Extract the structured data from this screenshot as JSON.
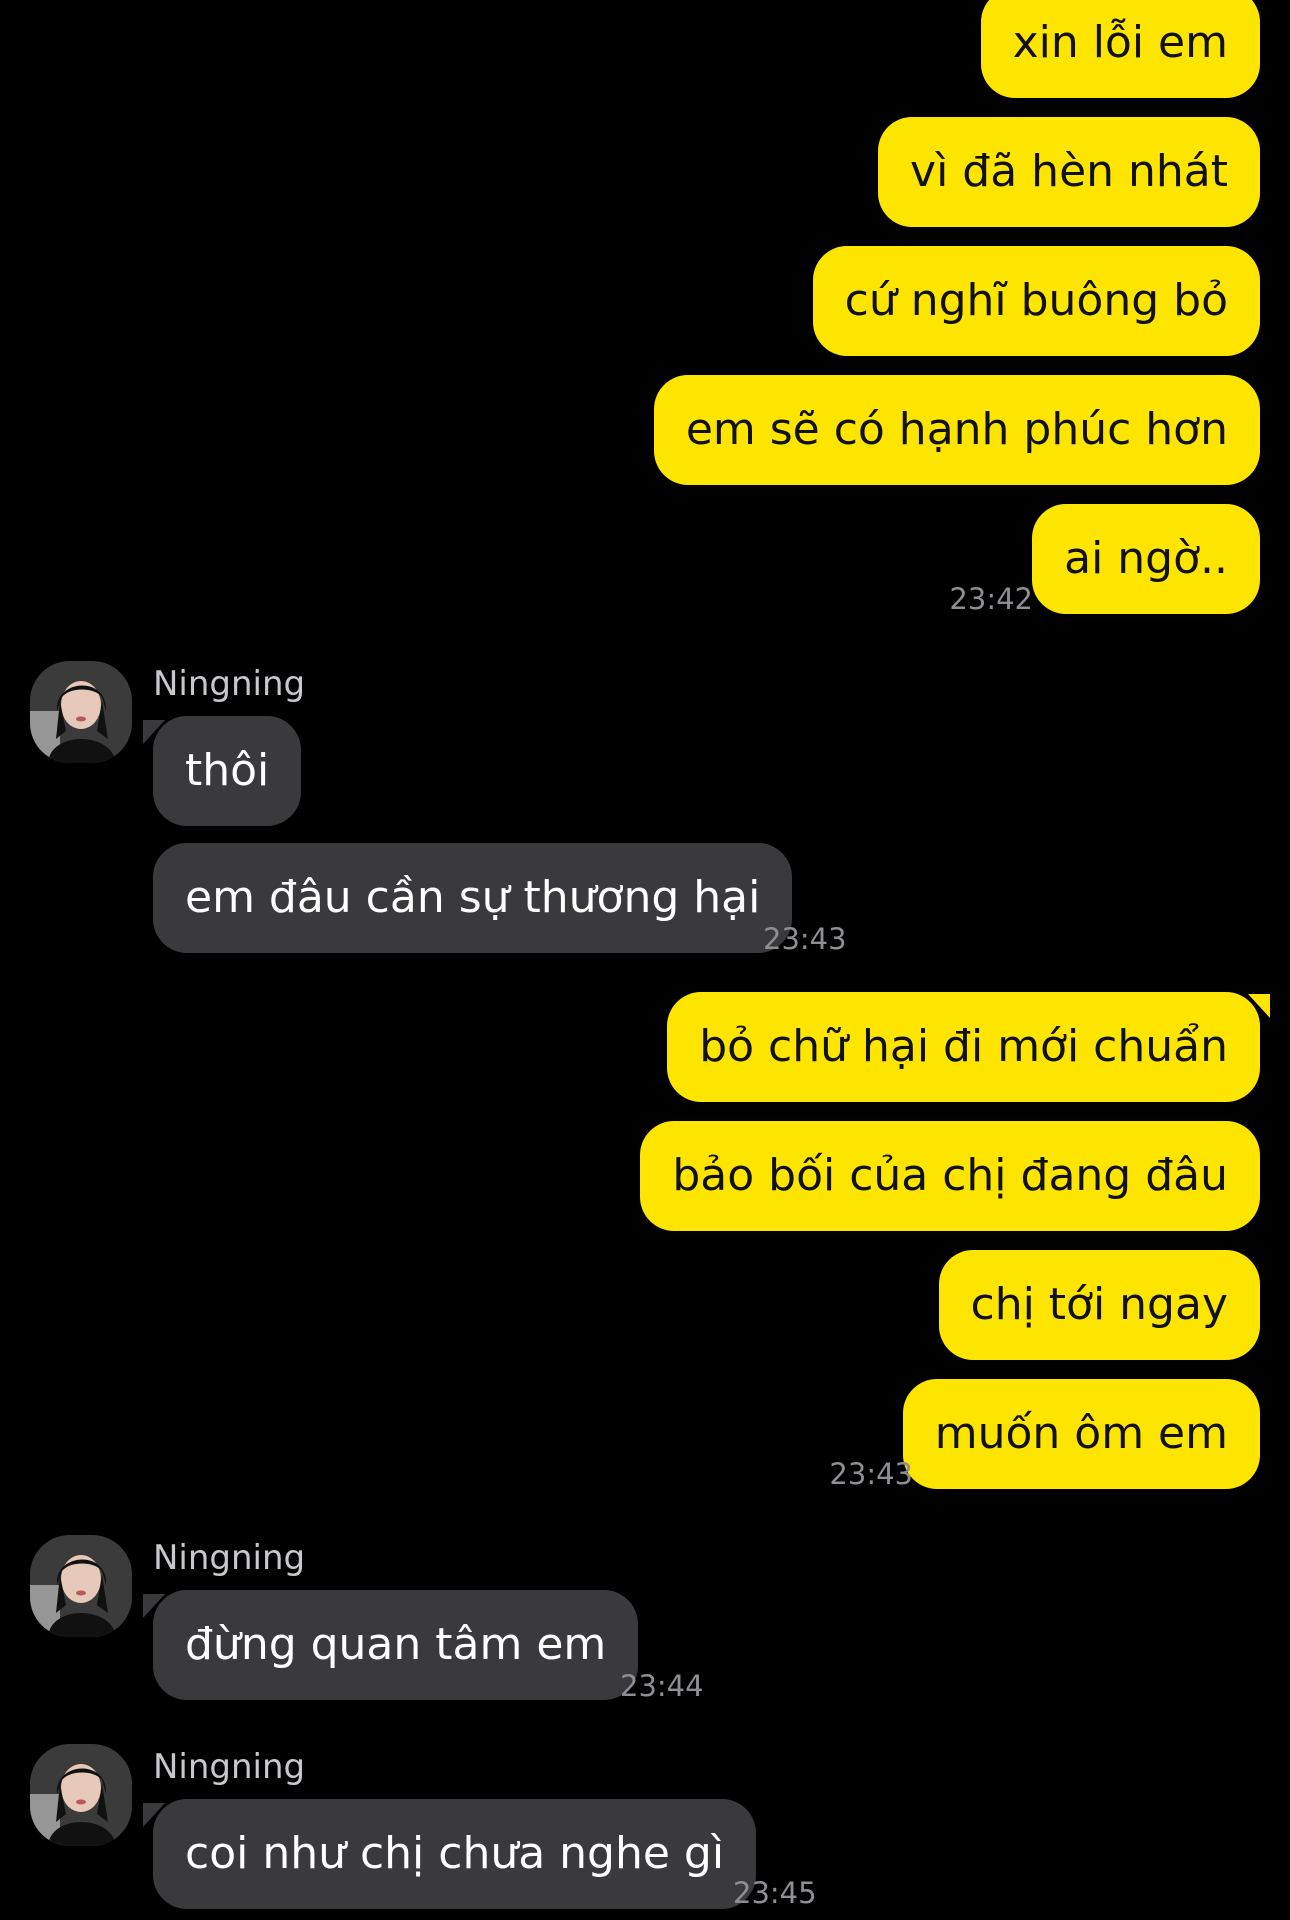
{
  "app": {
    "accent_color": "#FEE500",
    "incoming_bubble_color": "#3A3A3C",
    "background_color": "#000000"
  },
  "messages": [
    {
      "from": "me",
      "text": "xin lỗi em"
    },
    {
      "from": "me",
      "text": "vì đã hèn nhát"
    },
    {
      "from": "me",
      "text": "cứ nghĩ buông bỏ"
    },
    {
      "from": "me",
      "text": "em sẽ có hạnh phúc hơn"
    },
    {
      "from": "me",
      "text": "ai ngờ..",
      "time": "23:42"
    },
    {
      "from": "Ningning",
      "sender_name": "Ningning",
      "avatar": "profile-photo",
      "text": "thôi"
    },
    {
      "from": "Ningning",
      "text": "em đâu cần sự thương hại",
      "time": "23:43"
    },
    {
      "from": "me",
      "text": "bỏ chữ hại đi mới chuẩn"
    },
    {
      "from": "me",
      "text": "bảo bối của chị đang đâu"
    },
    {
      "from": "me",
      "text": "chị tới ngay"
    },
    {
      "from": "me",
      "text": "muốn ôm em",
      "time": "23:43"
    },
    {
      "from": "Ningning",
      "sender_name": "Ningning",
      "avatar": "profile-photo",
      "text": "đừng quan tâm em",
      "time": "23:44"
    },
    {
      "from": "Ningning",
      "sender_name": "Ningning",
      "avatar": "profile-photo",
      "text": "coi như chị chưa nghe gì",
      "time": "23:45"
    }
  ]
}
